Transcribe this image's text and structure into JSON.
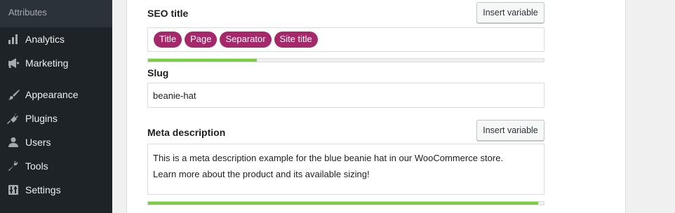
{
  "sidebar": {
    "submenu_item": "Attributes",
    "items": [
      {
        "label": "Analytics",
        "icon": "analytics-icon"
      },
      {
        "label": "Marketing",
        "icon": "megaphone-icon"
      },
      {
        "label": "Appearance",
        "icon": "paintbrush-icon"
      },
      {
        "label": "Plugins",
        "icon": "plugin-icon"
      },
      {
        "label": "Users",
        "icon": "users-icon"
      },
      {
        "label": "Tools",
        "icon": "wrench-icon"
      },
      {
        "label": "Settings",
        "icon": "settings-icon"
      }
    ]
  },
  "seo_title": {
    "label": "SEO title",
    "insert_button": "Insert variable",
    "variables": [
      "Title",
      "Page",
      "Separator",
      "Site title"
    ],
    "progress": 0.275,
    "progress_color": "#7ad03a"
  },
  "slug": {
    "label": "Slug",
    "value": "beanie-hat"
  },
  "meta_description": {
    "label": "Meta description",
    "insert_button": "Insert variable",
    "lines": [
      "This is a meta description example for the blue beanie hat in our WooCommerce store.",
      "Learn more about the product and its available sizing!"
    ],
    "progress": 0.985,
    "progress_color": "#7ad03a"
  },
  "colors": {
    "sidebar_bg": "#1d2327",
    "pill_bg": "#a4286a"
  }
}
